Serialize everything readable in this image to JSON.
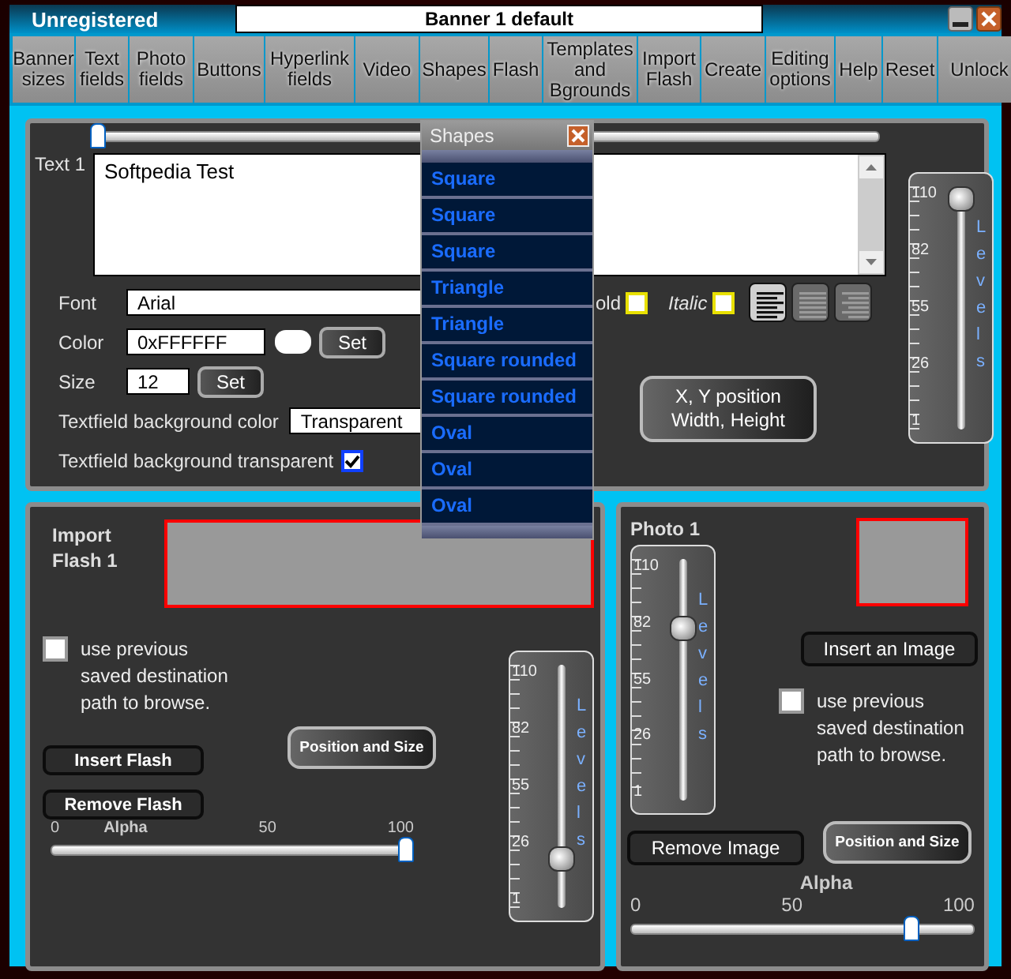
{
  "window": {
    "title": "Unregistered",
    "banner_name": "Banner 1 default"
  },
  "menu": [
    {
      "label": "Banner sizes"
    },
    {
      "label": "Text fields"
    },
    {
      "label": "Photo fields"
    },
    {
      "label": "Buttons"
    },
    {
      "label": "Hyperlink fields"
    },
    {
      "label": "Video"
    },
    {
      "label": "Shapes"
    },
    {
      "label": "Flash"
    },
    {
      "label": "Templates and Bgrounds"
    },
    {
      "label": "Import Flash"
    },
    {
      "label": "Create"
    },
    {
      "label": "Editing options"
    },
    {
      "label": "Help"
    },
    {
      "label": "Reset"
    },
    {
      "label": "Unlock"
    }
  ],
  "text_panel": {
    "position_slider": {
      "level": 0
    },
    "label": "Text 1",
    "text": "Softpedia Test",
    "font": {
      "label": "Font",
      "value": "Arial"
    },
    "bold": {
      "label": "old",
      "checked": false
    },
    "italic": {
      "label": "Italic",
      "checked": false
    },
    "alignment": [
      {
        "kind": "left",
        "selected": true
      },
      {
        "kind": "justify",
        "selected": false
      },
      {
        "kind": "right",
        "selected": false
      }
    ],
    "color": {
      "label": "Color",
      "value": "0xFFFFFF",
      "color": "#ffffff",
      "button": "Set"
    },
    "size": {
      "label": "Size",
      "value": "12",
      "button": "Set"
    },
    "background_color": {
      "label": "Textfield background color",
      "value": "Transparent"
    },
    "background_transparent": {
      "label": "Textfield background transparent",
      "checked": true
    },
    "position_button": "X, Y position Width, Height",
    "levels": {
      "title": "Levels",
      "ticks": [
        "110",
        "82",
        "55",
        "26",
        "1"
      ],
      "level": 1
    }
  },
  "shapes_popup": {
    "title": "Shapes",
    "items": [
      "Square",
      "Square",
      "Square",
      "Triangle",
      "Triangle",
      "Square rounded",
      "Square rounded",
      "Oval",
      "Oval",
      "Oval"
    ]
  },
  "flash_panel": {
    "title": "Import Flash 1",
    "use_previous": {
      "label": "use previous saved destination path to browse.",
      "checked": false
    },
    "insert_button": "Insert Flash",
    "remove_button": "Remove Flash",
    "position_button": "Position and Size",
    "alpha": {
      "title": "Alpha",
      "ticks": [
        "0",
        "50",
        "100"
      ],
      "level": 1
    },
    "levels": {
      "title": "Levels",
      "ticks": [
        "110",
        "82",
        "55",
        "26",
        "1"
      ],
      "level": 0.17
    }
  },
  "photo_panel": {
    "title": "Photo 1",
    "levels": {
      "title": "Levels",
      "ticks": [
        "110",
        "82",
        "55",
        "26",
        "1"
      ],
      "level": 0.74
    },
    "insert_button": "Insert an Image",
    "use_previous": {
      "label": "use previous saved destination path to browse.",
      "checked": false
    },
    "remove_button": "Remove Image",
    "position_button": "Position and Size",
    "alpha": {
      "title": "Alpha",
      "ticks": [
        "0",
        "50",
        "100"
      ],
      "level": 0.83
    }
  }
}
